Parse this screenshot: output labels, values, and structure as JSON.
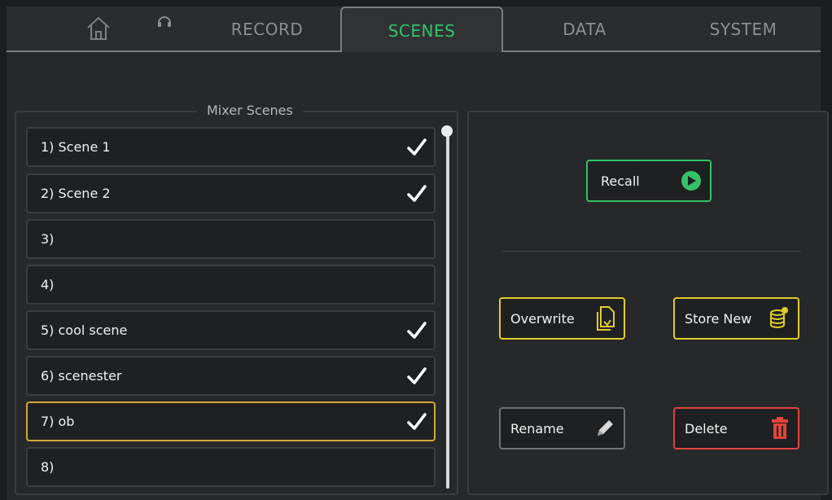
{
  "tabs": [
    {
      "label": "RECORD"
    },
    {
      "label": "SCENES"
    },
    {
      "label": "DATA"
    },
    {
      "label": "SYSTEM"
    }
  ],
  "active_tab": "SCENES",
  "scenes_panel": {
    "title": "Mixer Scenes",
    "rows": [
      {
        "label": "1) Scene 1",
        "stored": true
      },
      {
        "label": "2) Scene 2",
        "stored": true
      },
      {
        "label": "3)",
        "stored": false
      },
      {
        "label": "4)",
        "stored": false
      },
      {
        "label": "5) cool scene",
        "stored": true
      },
      {
        "label": "6) scenester",
        "stored": true
      },
      {
        "label": "7) ob",
        "stored": true
      },
      {
        "label": "8)",
        "stored": false
      }
    ],
    "selected_row": "7) ob"
  },
  "actions": {
    "recall": "Recall",
    "overwrite": "Overwrite",
    "store_new": "Store New",
    "rename": "Rename",
    "delete": "Delete"
  },
  "colors": {
    "accent_green": "#33c26a",
    "accent_yellow": "#e2cc2a",
    "accent_red": "#e0443c",
    "selection_orange": "#d2a83a"
  },
  "icons": {
    "home": "home-icon",
    "headphones": "headphones-icon",
    "check": "check-icon",
    "play": "play-icon",
    "overwrite": "overwrite-document-icon",
    "store": "database-add-icon",
    "rename": "pencil-icon",
    "delete": "trash-icon"
  }
}
